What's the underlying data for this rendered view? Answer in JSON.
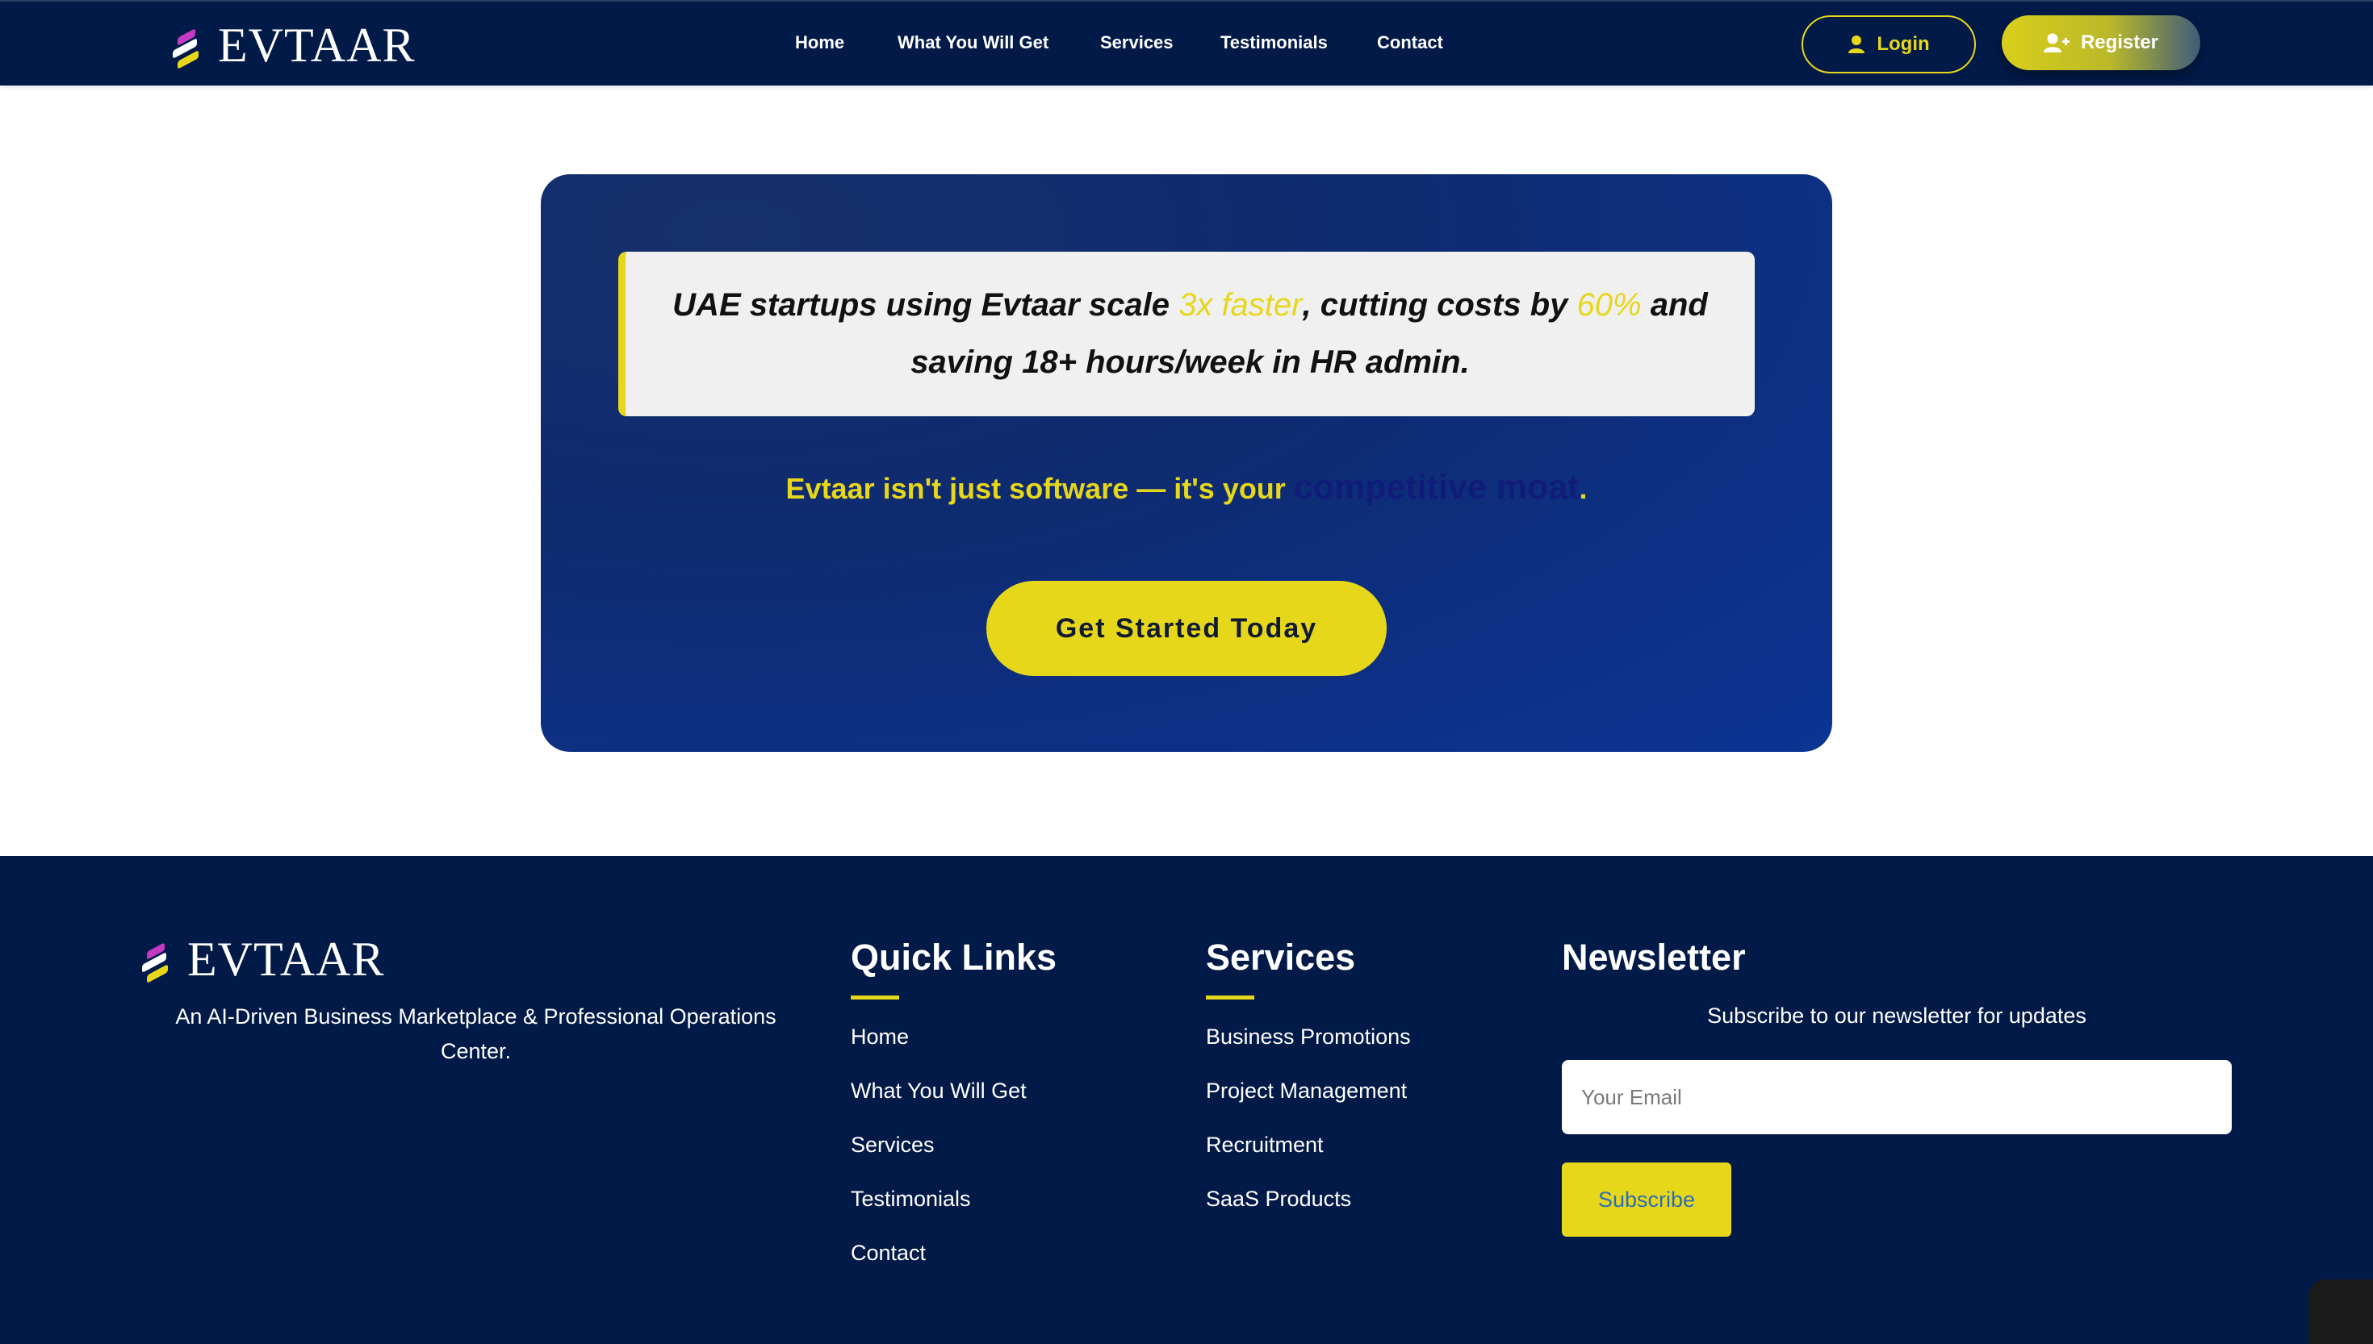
{
  "brand": {
    "name": "EVTAAR",
    "mark_colors": [
      "#c53ac2",
      "#ffffff",
      "#e7d71b"
    ]
  },
  "nav": {
    "links": [
      "Home",
      "What You Will Get",
      "Services",
      "Testimonials",
      "Contact"
    ],
    "login_label": "Login",
    "login_icon": "user-icon",
    "register_label": "Register",
    "register_icon": "user-plus-icon"
  },
  "cta": {
    "quote_part1": "UAE startups using Evtaar scale ",
    "quote_hl1": "3x faster",
    "quote_part2": ", cutting costs by ",
    "quote_hl2": "60%",
    "quote_part3": " and saving 18+ hours/week in HR admin.",
    "tagline_main": "Evtaar isn't just software — it's your ",
    "tagline_emphasis": "competitive moat",
    "tagline_end": ".",
    "button_label": "Get Started Today"
  },
  "footer": {
    "description": "An AI-Driven Business Marketplace & Professional Operations Center.",
    "quick_links": {
      "title": "Quick Links",
      "items": [
        "Home",
        "What You Will Get",
        "Services",
        "Testimonials",
        "Contact"
      ]
    },
    "services": {
      "title": "Services",
      "items": [
        "Business Promotions",
        "Project Management",
        "Recruitment",
        "SaaS Products"
      ]
    },
    "newsletter": {
      "title": "Newsletter",
      "subtitle": "Subscribe to our newsletter for updates",
      "email_placeholder": "Your Email",
      "button_label": "Subscribe"
    }
  },
  "colors": {
    "navy": "#021a47",
    "accent_yellow": "#e7d71b",
    "card_blue": "#0b3494"
  }
}
